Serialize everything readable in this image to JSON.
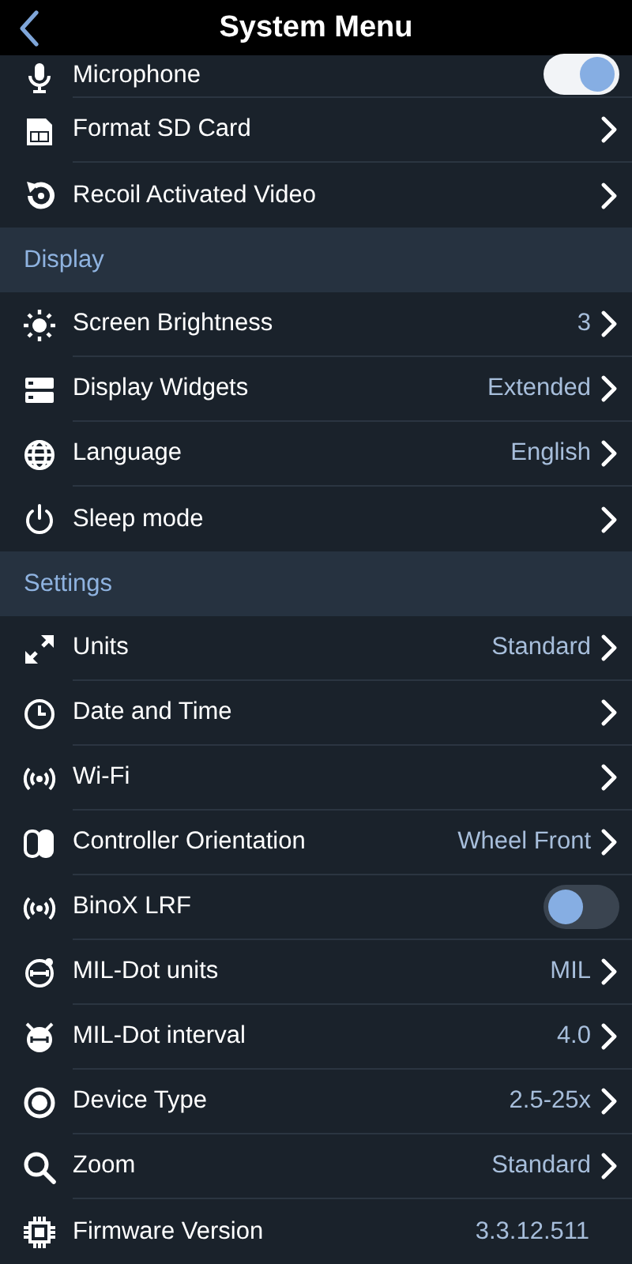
{
  "header": {
    "title": "System Menu"
  },
  "sections": [
    {
      "items": [
        {
          "kind": "toggle",
          "label": "Microphone",
          "on": true
        },
        {
          "kind": "link",
          "label": "Format SD Card"
        },
        {
          "kind": "link",
          "label": "Recoil Activated Video"
        }
      ]
    },
    {
      "title": "Display",
      "items": [
        {
          "kind": "link",
          "label": "Screen Brightness",
          "value": "3"
        },
        {
          "kind": "link",
          "label": "Display Widgets",
          "value": "Extended"
        },
        {
          "kind": "link",
          "label": "Language",
          "value": "English"
        },
        {
          "kind": "link",
          "label": "Sleep mode"
        }
      ]
    },
    {
      "title": "Settings",
      "items": [
        {
          "kind": "link",
          "label": "Units",
          "value": "Standard"
        },
        {
          "kind": "link",
          "label": "Date and Time"
        },
        {
          "kind": "link",
          "label": "Wi-Fi"
        },
        {
          "kind": "link",
          "label": "Controller Orientation",
          "value": "Wheel Front"
        },
        {
          "kind": "toggle",
          "label": "BinoX LRF",
          "on": false
        },
        {
          "kind": "link",
          "label": "MIL-Dot units",
          "value": "MIL"
        },
        {
          "kind": "link",
          "label": "MIL-Dot interval",
          "value": "4.0"
        },
        {
          "kind": "link",
          "label": "Device Type",
          "value": "2.5-25x"
        },
        {
          "kind": "link",
          "label": "Zoom",
          "value": "Standard"
        },
        {
          "kind": "info",
          "label": "Firmware Version",
          "value": "3.3.12.511"
        }
      ]
    }
  ]
}
